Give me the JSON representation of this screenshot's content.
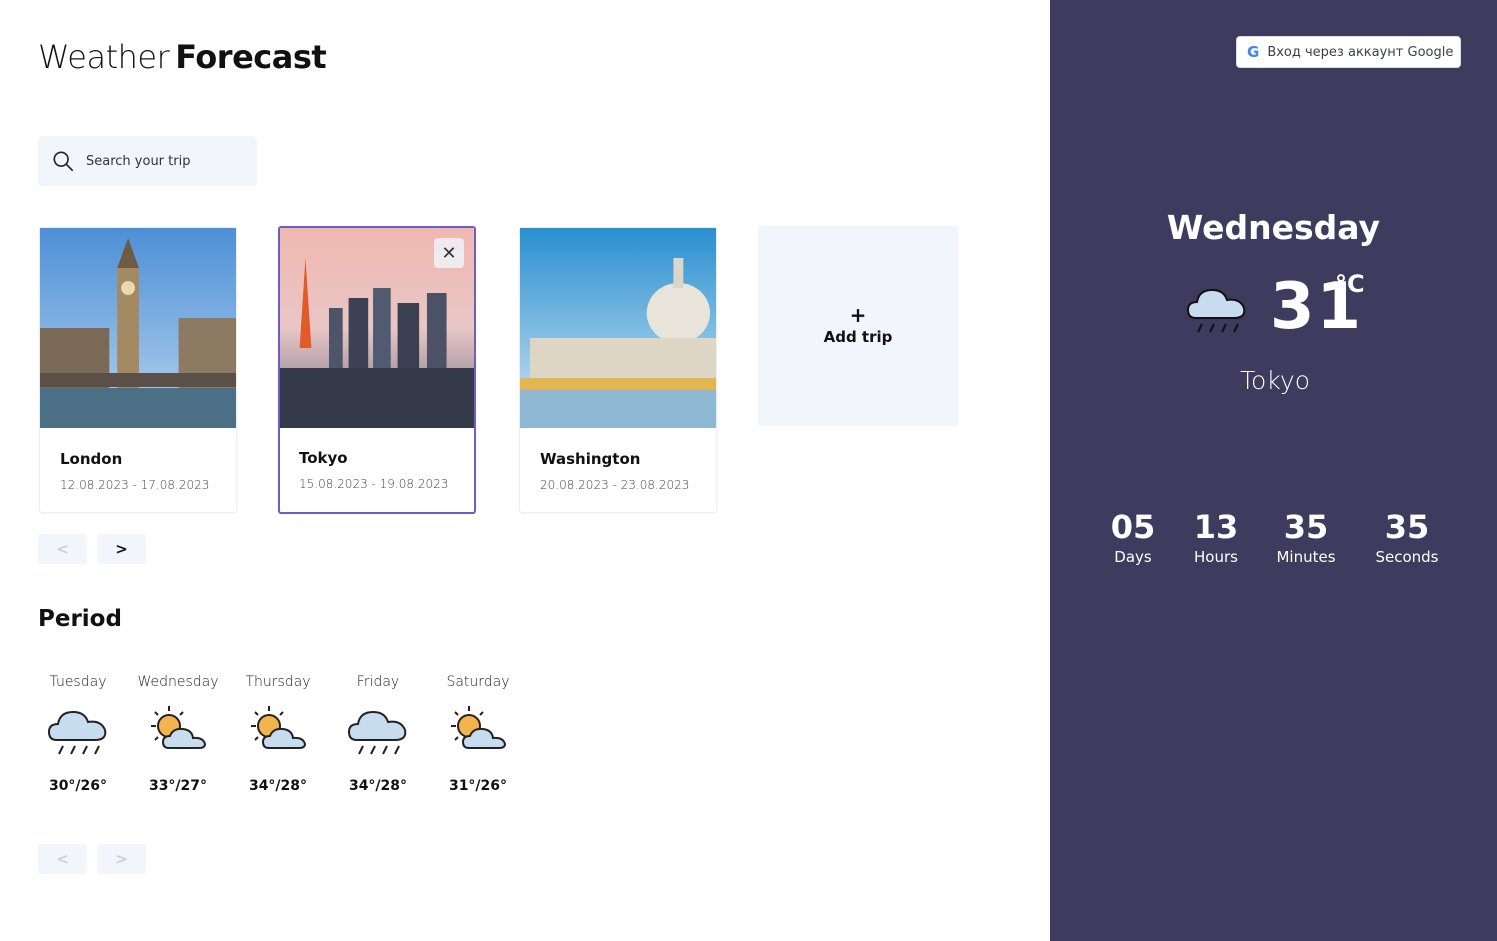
{
  "app": {
    "title_light": "Weather",
    "title_bold": "Forecast"
  },
  "search": {
    "placeholder": "Search your trip"
  },
  "trips": [
    {
      "city": "London",
      "dates": "12.08.2023 - 17.08.2023"
    },
    {
      "city": "Tokyo",
      "dates": "15.08.2023 - 19.08.2023"
    },
    {
      "city": "Washington",
      "dates": "20.08.2023 - 23.08.2023"
    }
  ],
  "add_trip": {
    "plus": "+",
    "label": "Add trip"
  },
  "trip_pager": {
    "prev": "<",
    "next": ">"
  },
  "period": {
    "title": "Period",
    "days": [
      {
        "name": "Tuesday",
        "temp": "30°/26°",
        "icon": "rain-cloud-icon"
      },
      {
        "name": "Wednesday",
        "temp": "33°/27°",
        "icon": "sun-cloud-icon"
      },
      {
        "name": "Thursday",
        "temp": "34°/28°",
        "icon": "sun-cloud-icon"
      },
      {
        "name": "Friday",
        "temp": "34°/28°",
        "icon": "rain-cloud-icon"
      },
      {
        "name": "Saturday",
        "temp": "31°/26°",
        "icon": "sun-cloud-icon"
      }
    ],
    "pager": {
      "prev": "<",
      "next": ">"
    }
  },
  "side": {
    "google_button": "Вход через аккаунт Google",
    "google_glyph": "G",
    "day": "Wednesday",
    "temp": "31",
    "unit": "°C",
    "city": "Tokyo",
    "countdown": [
      {
        "value": "05",
        "label": "Days"
      },
      {
        "value": "13",
        "label": "Hours"
      },
      {
        "value": "35",
        "label": "Minutes"
      },
      {
        "value": "35",
        "label": "Seconds"
      }
    ]
  },
  "colors": {
    "sidebar": "#3e3b5e",
    "accent": "#6b5fc7",
    "card_bg": "#f2f5fb"
  }
}
